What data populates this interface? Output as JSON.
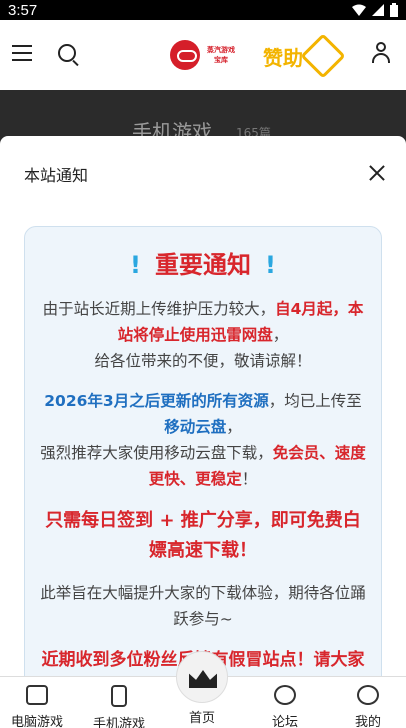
{
  "status": {
    "time": "3:57"
  },
  "header": {
    "logo_text": "蒸汽游戏宝库",
    "donate_label": "赞助"
  },
  "banner": {
    "title": "手机游戏",
    "count": "165篇"
  },
  "modal": {
    "title": "本站通知",
    "heading": "重要通知",
    "p1_a": "由于站长近期上传维护压力较大，",
    "p1_b": "自4月起，本站将停止使用迅雷网盘",
    "p1_c": "，",
    "p1_d": "给各位带来的不便，敬请谅解！",
    "p2_a": "2026年3月之后更新的所有资源",
    "p2_b": "，均已上传至",
    "p2_c": "移动云盘",
    "p2_d": "，",
    "p2_e": "强烈推荐大家使用移动云盘下载，",
    "p2_f": "免会员、速度更快、更稳定",
    "p2_g": "！",
    "p3": "只需每日签到 + 推广分享，即可免费白嫖高速下载！",
    "p4": "此举旨在大幅提升大家的下载体验，期待各位踊跃参与~",
    "p5": "近期收到多位粉丝反馈有假冒站点！请大家务必警惕，请认准本站网址勿到收藏"
  },
  "nav": {
    "items": [
      {
        "label": "电脑游戏"
      },
      {
        "label": "手机游戏"
      },
      {
        "label": "首页"
      },
      {
        "label": "论坛"
      },
      {
        "label": "我的"
      }
    ]
  }
}
